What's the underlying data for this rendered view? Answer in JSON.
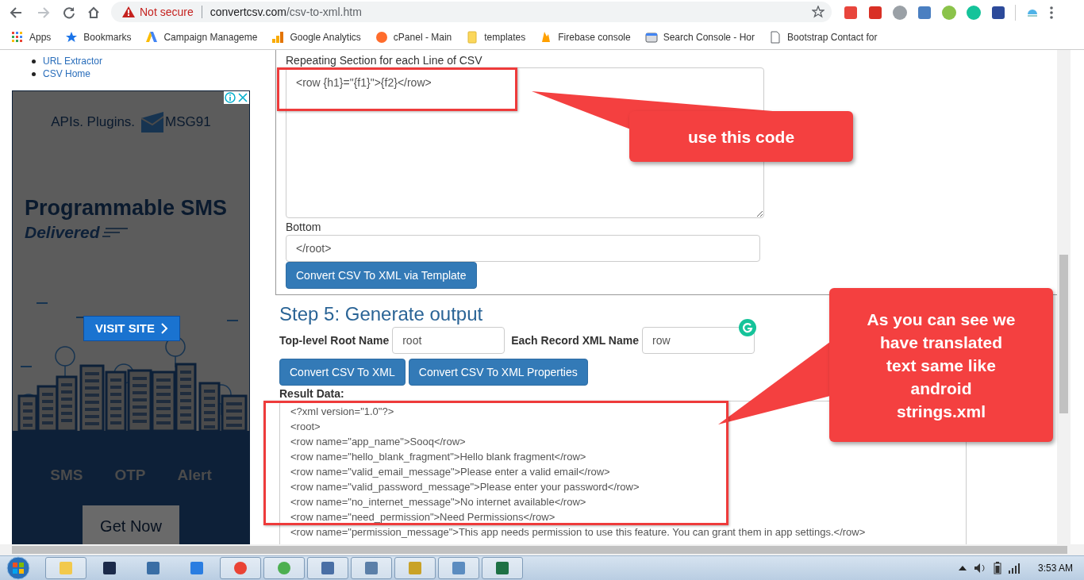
{
  "browser": {
    "security_label": "Not secure",
    "url_host": "convertcsv.com",
    "url_path": "/csv-to-xml.htm"
  },
  "bookmarks": [
    {
      "label": "Apps",
      "kind": "apps"
    },
    {
      "label": "Bookmarks",
      "kind": "star"
    },
    {
      "label": "Campaign Manageme",
      "kind": "triangle"
    },
    {
      "label": "Google Analytics",
      "kind": "bars"
    },
    {
      "label": "cPanel - Main",
      "kind": "cpanel"
    },
    {
      "label": "templates",
      "kind": "folder"
    },
    {
      "label": "Firebase console",
      "kind": "flame"
    },
    {
      "label": "Search Console - Hor",
      "kind": "console"
    },
    {
      "label": "Bootstrap Contact for",
      "kind": "page"
    }
  ],
  "sidebar": {
    "links": [
      "URL Extractor",
      "CSV Home"
    ]
  },
  "ad": {
    "brand_line": "APIs. Plugins.",
    "brand": "MSG91",
    "headline": "Programmable SMS",
    "subheadline": "Delivered",
    "cta": "VISIT SITE",
    "features": [
      "SMS",
      "OTP",
      "Alert"
    ],
    "button": "Get Now"
  },
  "template": {
    "repeat_label": "Repeating Section for each Line of CSV",
    "repeat_value": "<row {h1}=\"{f1}\">{f2}</row>",
    "bottom_label": "Bottom",
    "bottom_value": "</root>",
    "button": "Convert CSV To XML via Template"
  },
  "step5": {
    "heading": "Step 5: Generate output",
    "fields": [
      {
        "label": "Top-level Root Name",
        "value": "root"
      },
      {
        "label": "Each Record XML Name",
        "value": "row"
      }
    ],
    "buttons": [
      "Convert CSV To XML",
      "Convert CSV To XML Properties"
    ],
    "result_label": "Result Data:",
    "result_lines": [
      "<?xml version=\"1.0\"?>",
      "<root>",
      "<row name=\"app_name\">Sooq</row>",
      "<row name=\"hello_blank_fragment\">Hello blank fragment</row>",
      "<row name=\"valid_email_message\">Please enter a valid email</row>",
      "<row name=\"valid_password_message\">Please enter your password</row>",
      "<row name=\"no_internet_message\">No internet available</row>",
      "<row name=\"need_permission\">Need Permissions</row>",
      "<row name=\"permission_message\">This app needs permission to use this feature. You can grant them in app settings.</row>"
    ]
  },
  "annotations": [
    {
      "text": "use this code"
    },
    {
      "text": "As you can see we have translated text same like android strings.xml"
    }
  ],
  "taskbar": {
    "clock": "3:53 AM"
  }
}
